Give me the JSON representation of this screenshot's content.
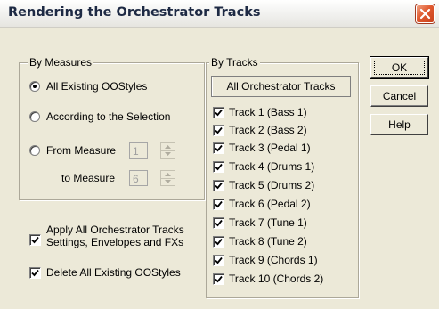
{
  "window": {
    "title": "Rendering the Orchestrator Tracks"
  },
  "by_measures": {
    "legend": "By Measures",
    "options": [
      {
        "label": "All Existing OOStyles",
        "selected": true
      },
      {
        "label": "According to the Selection",
        "selected": false
      },
      {
        "label": "From Measure",
        "selected": false
      }
    ],
    "from_value": "1",
    "to_label": "to Measure",
    "to_value": "6"
  },
  "apply_all": {
    "label_line1": "Apply All Orchestrator Tracks",
    "label_line2": "Settings, Envelopes and FXs",
    "checked": true
  },
  "delete_all": {
    "label": "Delete All Existing OOStyles",
    "checked": true
  },
  "by_tracks": {
    "legend": "By Tracks",
    "all_button": "All Orchestrator Tracks",
    "tracks": [
      {
        "label": "Track 1 (Bass 1)",
        "checked": true
      },
      {
        "label": "Track 2 (Bass 2)",
        "checked": true
      },
      {
        "label": "Track 3 (Pedal 1)",
        "checked": true
      },
      {
        "label": "Track 4 (Drums 1)",
        "checked": true
      },
      {
        "label": "Track 5 (Drums 2)",
        "checked": true
      },
      {
        "label": "Track 6 (Pedal 2)",
        "checked": true
      },
      {
        "label": "Track 7 (Tune 1)",
        "checked": true
      },
      {
        "label": "Track 8 (Tune 2)",
        "checked": true
      },
      {
        "label": "Track 9 (Chords 1)",
        "checked": true
      },
      {
        "label": "Track 10 (Chords 2)",
        "checked": true
      }
    ]
  },
  "buttons": {
    "ok": "OK",
    "cancel": "Cancel",
    "help": "Help"
  }
}
